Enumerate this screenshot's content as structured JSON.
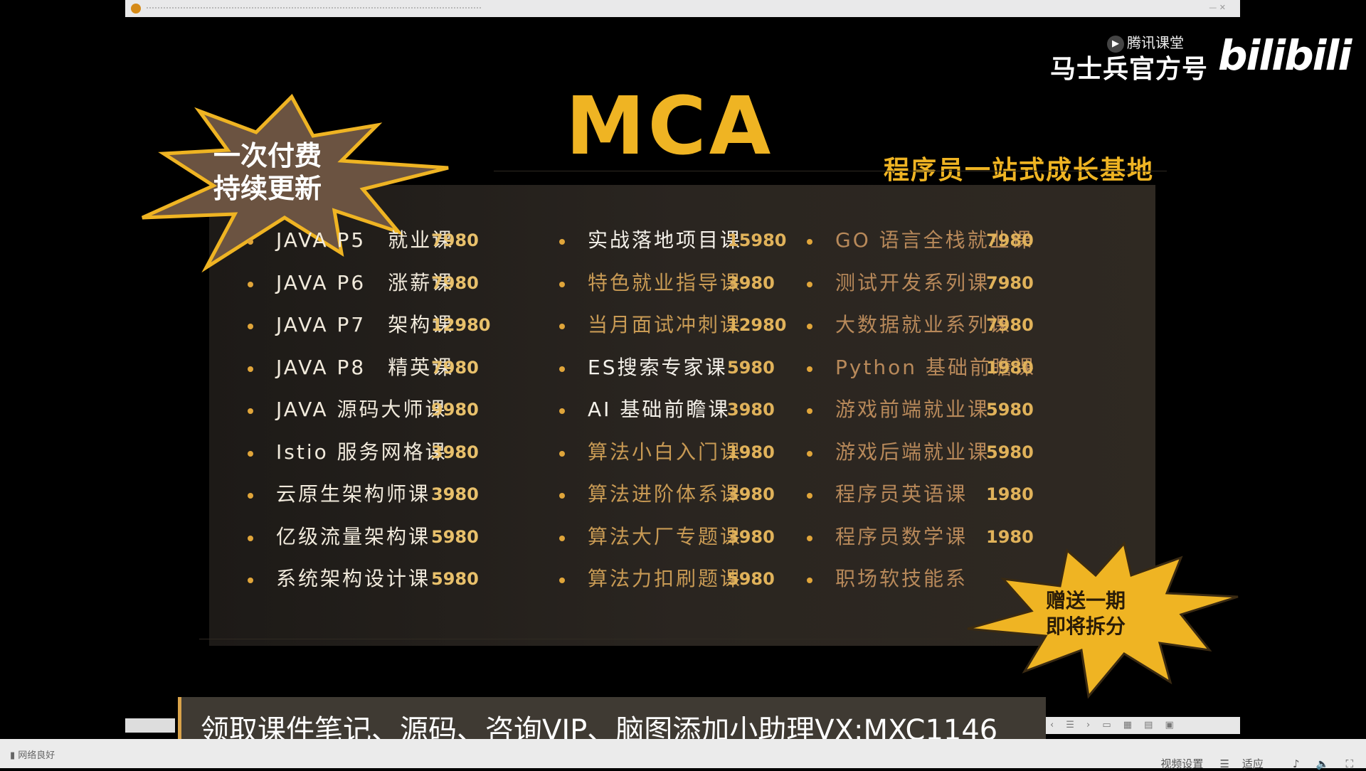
{
  "window": {
    "app_icon": "tencent-classroom-icon",
    "controls": "— ✕"
  },
  "branding": {
    "tencent_label": "腾讯课堂",
    "official_account": "马士兵官方号",
    "bilibili_logo": "bilibili"
  },
  "slide": {
    "title": "MCA",
    "tagline": "程序员一站式成长基地",
    "burst_top": [
      "一次付费",
      "持续更新"
    ],
    "burst_bottom": [
      "赠送一期",
      "即将拆分"
    ],
    "columns": [
      [
        {
          "name": "JAVA P5　就业课",
          "price": "7980"
        },
        {
          "name": "JAVA P6　涨薪课",
          "price": "7980"
        },
        {
          "name": "JAVA P7　架构课",
          "price": "12980"
        },
        {
          "name": "JAVA P8　精英课",
          "price": "7980"
        },
        {
          "name": "JAVA 源码大师课",
          "price": "9980"
        },
        {
          "name": "Istio 服务网格课",
          "price": "3980"
        },
        {
          "name": "云原生架构师课",
          "price": "3980"
        },
        {
          "name": "亿级流量架构课",
          "price": "5980"
        },
        {
          "name": "系统架构设计课",
          "price": "5980"
        }
      ],
      [
        {
          "name": "实战落地项目课",
          "price": "15980"
        },
        {
          "name": "特色就业指导课",
          "price": "3980"
        },
        {
          "name": "当月面试冲刺课",
          "price": "12980"
        },
        {
          "name": "ES搜索专家课",
          "price": "5980"
        },
        {
          "name": "AI 基础前瞻课",
          "price": "3980"
        },
        {
          "name": "算法小白入门课",
          "price": "1980"
        },
        {
          "name": "算法进阶体系课",
          "price": "3980"
        },
        {
          "name": "算法大厂专题课",
          "price": "3980"
        },
        {
          "name": "算法力扣刷题课",
          "price": "5980"
        }
      ],
      [
        {
          "name": "GO 语言全栈就业课",
          "price": "7980"
        },
        {
          "name": "测试开发系列课",
          "price": "7980"
        },
        {
          "name": "大数据就业系列课",
          "price": "7980"
        },
        {
          "name": "Python 基础前瞻课",
          "price": "1980"
        },
        {
          "name": "游戏前端就业课",
          "price": "5980"
        },
        {
          "name": "游戏后端就业课",
          "price": "5980"
        },
        {
          "name": "程序员英语课",
          "price": "1980"
        },
        {
          "name": "程序员数学课",
          "price": "1980"
        },
        {
          "name": "职场软技能系",
          "price": ""
        }
      ]
    ]
  },
  "subtitle": "领取课件笔记、源码、咨询VIP、脑图添加小助理VX:MXC1146",
  "statusbar": {
    "left": "网络良好",
    "video_settings": "视频设置",
    "fit": "适应"
  },
  "colors": {
    "gold": "#efb423",
    "burst": "#6b5341",
    "burst_bottom": "#efb423"
  }
}
